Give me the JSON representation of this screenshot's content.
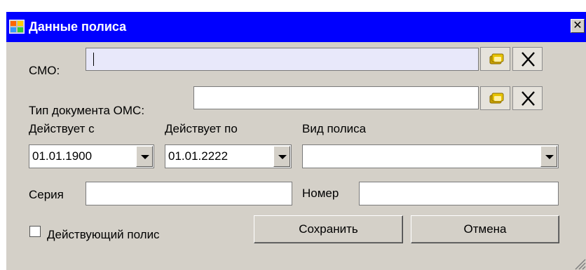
{
  "window": {
    "title": "Данные полиса",
    "close_glyph": "✕",
    "titlebar_color": "#0000ff",
    "background_color": "#d4d0c8"
  },
  "smo": {
    "label": "СМО:",
    "value": "",
    "lookup_icon": "folder-lookup-icon",
    "clear_icon": "clear-x-icon"
  },
  "doc_type": {
    "label": "Тип документа ОМС:",
    "value": "",
    "lookup_icon": "folder-lookup-icon",
    "clear_icon": "clear-x-icon"
  },
  "valid_from": {
    "label": "Действует с",
    "value": "01.01.1900"
  },
  "valid_to": {
    "label": "Действует по",
    "value": "01.01.2222"
  },
  "policy_type": {
    "label": "Вид полиса",
    "value": ""
  },
  "series": {
    "label": "Серия",
    "value": ""
  },
  "number": {
    "label": "Номер",
    "value": ""
  },
  "active_policy": {
    "label": "Действующий полис",
    "checked": false
  },
  "buttons": {
    "save": "Сохранить",
    "cancel": "Отмена"
  }
}
